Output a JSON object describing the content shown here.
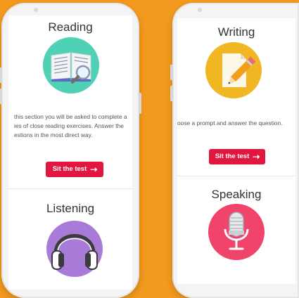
{
  "left_phone": {
    "reading": {
      "title": "Reading",
      "description_lines": [
        "this section you will be asked to complete a",
        "ies of close reading exercises. Answer the",
        "estions in the most direct way."
      ],
      "button_label": "Sit the test",
      "icon": "book-magnifier-icon"
    },
    "listening": {
      "title": "Listening",
      "icon": "headphones-icon"
    }
  },
  "right_phone": {
    "writing": {
      "title": "Writing",
      "description_lines": [
        "oose a prompt and answer the question."
      ],
      "button_label": "Sit the test",
      "icon": "paper-pencil-icon"
    },
    "speaking": {
      "title": "Speaking",
      "icon": "microphone-icon"
    }
  },
  "colors": {
    "background": "#f39a1e",
    "button": "#e2173f",
    "reading_circle": "#4fd1b5",
    "listening_circle": "#a97bd9",
    "writing_circle": "#f1b623",
    "speaking_circle": "#f0446b"
  }
}
